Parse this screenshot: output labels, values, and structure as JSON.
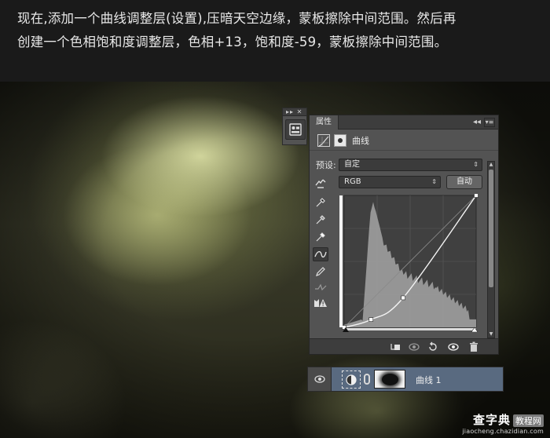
{
  "instructions": {
    "line1": "现在,添加一个曲线调整层(设置),压暗天空边缘，蒙板擦除中间范围。然后再",
    "line2": "创建一个色相饱和度调整层，色相+13，饱和度-59，蒙板擦除中间范围。"
  },
  "dock": {
    "collapse_glyph": "▸▸ ✕",
    "icon": "properties-icon"
  },
  "panel": {
    "tab_label": "属性",
    "collapse_glyph": "◂◂",
    "menu_glyph": "▾≡",
    "title": "曲线",
    "preset_label": "预设:",
    "preset_value": "自定",
    "channel_value": "RGB",
    "auto_label": "自动",
    "select_arrows": "⇕",
    "tools": [
      "on-image-adjust-icon",
      "black-eyedropper-icon",
      "gray-eyedropper-icon",
      "white-eyedropper-icon",
      "curve-points-icon",
      "pencil-icon",
      "smooth-icon",
      "clipping-warning-icon"
    ],
    "curve_points": [
      [
        0,
        0
      ],
      [
        52,
        15
      ],
      [
        114,
        57
      ],
      [
        255,
        255
      ]
    ],
    "footer_icons": [
      "clip-to-layer-icon",
      "view-previous-icon",
      "reset-icon",
      "visibility-icon",
      "delete-icon"
    ]
  },
  "layer": {
    "name": "曲线 1"
  },
  "watermark": {
    "main": "查字典",
    "box": "教程网",
    "url": "jiaocheng.chazidian.com"
  },
  "colors": {
    "panel_bg": "#535353",
    "panel_dark": "#3d3d3d",
    "layer_selected": "#596a80",
    "histogram": "#9a9a9a"
  }
}
